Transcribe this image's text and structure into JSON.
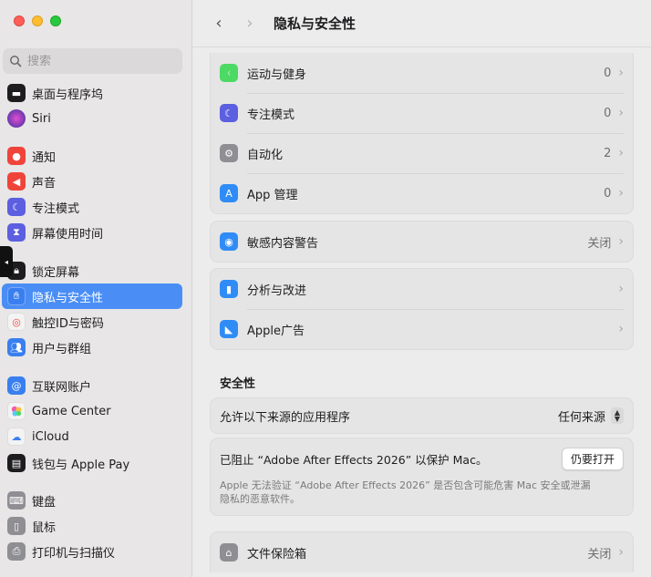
{
  "window": {
    "traffic_lights": {
      "close": "#ff5f57",
      "minimize": "#febc2e",
      "zoom": "#28c840"
    }
  },
  "sidebar": {
    "search_placeholder": "搜索",
    "items": [
      {
        "label": "桌面与程序坞",
        "icon": "dock-icon",
        "color": "#1d1d1f"
      },
      {
        "label": "Siri",
        "icon": "siri-icon",
        "color": "#6e3fd8"
      },
      {
        "label": "通知",
        "icon": "bell-icon",
        "color": "#f0443a"
      },
      {
        "label": "声音",
        "icon": "speaker-icon",
        "color": "#f0443a"
      },
      {
        "label": "专注模式",
        "icon": "moon-icon",
        "color": "#5b5fe0"
      },
      {
        "label": "屏幕使用时间",
        "icon": "hourglass-icon",
        "color": "#5b5fe0"
      },
      {
        "label": "锁定屏幕",
        "icon": "lock-icon",
        "color": "#1d1d1f"
      },
      {
        "label": "隐私与安全性",
        "icon": "hand-icon",
        "color": "#3a7ff0",
        "active": true
      },
      {
        "label": "触控ID与密码",
        "icon": "fingerprint-icon",
        "color": "#f3f3f3"
      },
      {
        "label": "用户与群组",
        "icon": "users-icon",
        "color": "#3a7ff0"
      },
      {
        "label": "互联网账户",
        "icon": "at-icon",
        "color": "#3a7ff0"
      },
      {
        "label": "Game Center",
        "icon": "game-center-icon",
        "color": "#f3f3f3"
      },
      {
        "label": "iCloud",
        "icon": "cloud-icon",
        "color": "#f3f3f3"
      },
      {
        "label": "钱包与 Apple Pay",
        "icon": "wallet-icon",
        "color": "#1d1d1f"
      },
      {
        "label": "键盘",
        "icon": "keyboard-icon",
        "color": "#8e8e93"
      },
      {
        "label": "鼠标",
        "icon": "mouse-icon",
        "color": "#8e8e93"
      },
      {
        "label": "打印机与扫描仪",
        "icon": "printer-icon",
        "color": "#8e8e93"
      }
    ]
  },
  "header": {
    "title": "隐私与安全性"
  },
  "cards": {
    "apps": [
      {
        "label": "运动与健身",
        "value": "0",
        "icon": "fitness-icon",
        "color": "#4cd964"
      },
      {
        "label": "专注模式",
        "value": "0",
        "icon": "moon-icon",
        "color": "#5b5fe0"
      },
      {
        "label": "自动化",
        "value": "2",
        "icon": "gears-icon",
        "color": "#8e8e93"
      },
      {
        "label": "App 管理",
        "value": "0",
        "icon": "app-store-icon",
        "color": "#2f8cf6"
      }
    ],
    "sensitive": {
      "label": "敏感内容警告",
      "value": "关闭",
      "icon": "eye-icon",
      "color": "#2f8cf6"
    },
    "analytics": [
      {
        "label": "分析与改进",
        "icon": "chart-icon",
        "color": "#2f8cf6"
      },
      {
        "label": "Apple广告",
        "icon": "megaphone-icon",
        "color": "#2f8cf6"
      }
    ]
  },
  "security": {
    "section_title": "安全性",
    "allow_label": "允许以下来源的应用程序",
    "allow_value": "任何来源",
    "blocked_label": "已阻止 “Adobe After Effects 2026” 以保护 Mac。",
    "open_button": "仍要打开",
    "note_line1": "Apple 无法验证 “Adobe After Effects 2026” 是否包含可能危害 Mac 安全或泄漏",
    "note_line2": "隐私的恶意软件。"
  },
  "filevault": {
    "label": "文件保险箱",
    "value": "关闭",
    "icon": "vault-icon",
    "color": "#8e8e93"
  }
}
